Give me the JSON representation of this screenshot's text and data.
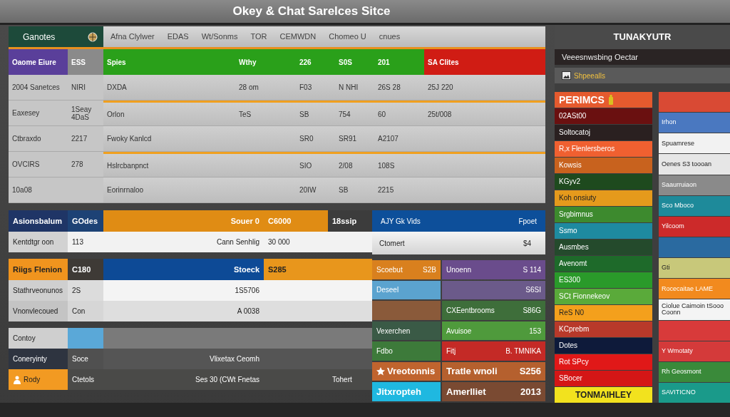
{
  "window": {
    "title": "Okey & Chat Sarelces Sitce"
  },
  "board": {
    "corner": "Ganotes",
    "header": [
      "Afna Clylwer",
      "EDAS",
      "Wt/Sonms",
      "TOR",
      "CEMWDN",
      "Chomeo U",
      "cnues"
    ],
    "rows": [
      {
        "kind": "accent",
        "rule_above": false,
        "cells": [
          "Oaome Eiure",
          "ESS",
          "Spies",
          "Wthy",
          "226",
          "S0S",
          "201",
          "SA Clites"
        ]
      },
      {
        "kind": "plain",
        "rule_above": false,
        "cells": [
          "2004 Sanetces",
          "NIRI",
          "DXDA",
          "28 om",
          "F03",
          "N NHI",
          "26S 28",
          "25J 220"
        ]
      },
      {
        "kind": "plain",
        "rule_above": true,
        "cells": [
          "Eaxesey",
          "1Seay 4DaS",
          "Orlon",
          "TeS",
          "SB",
          "754",
          "60",
          "25t/008"
        ]
      },
      {
        "kind": "plain",
        "rule_above": false,
        "cells": [
          "Ctbraxdo",
          "2217",
          "Fwoky Kanlcd",
          null,
          "SR0",
          "SR91",
          "A2107",
          null
        ]
      },
      {
        "kind": "plain",
        "rule_above": true,
        "cells": [
          "OVCIRS",
          "278",
          "Hslrcbanpnct",
          null,
          "SIO",
          "2/08",
          "108S",
          null
        ]
      },
      {
        "kind": "plain",
        "rule_above": false,
        "cells": [
          "10a08",
          null,
          "Eorinrnaloo",
          null,
          "20IW",
          "SB",
          "2215",
          null
        ]
      }
    ]
  },
  "ledger": [
    {
      "kind": "band",
      "cells": [
        {
          "text": "Asionsbalum",
          "color": "#1f3566"
        },
        {
          "text": "GOdes",
          "color": "#1d4275"
        },
        {
          "text": "Souer 0",
          "color": "#e08c14"
        },
        {
          "text": "C6000",
          "color": "#e08c14"
        },
        {
          "text": "18ssip",
          "color": "#3c3c3c"
        }
      ]
    },
    {
      "kind": "line",
      "cells": [
        {
          "text": "Kentdtgr oon",
          "color": "#d2d2d2"
        },
        {
          "text": "113",
          "color": "#f2f2f2"
        },
        {
          "text": "Cann Senhlig",
          "color": "#f2f2f2"
        },
        {
          "text": "30 000",
          "color": "#f2f2f2"
        },
        {
          "color": "#f2f2f2"
        }
      ]
    },
    {
      "kind": "gap"
    },
    {
      "kind": "band",
      "cells": [
        {
          "text": "Riigs Flenion",
          "color": "#f0941e"
        },
        {
          "text": "C180",
          "color": "#3e3a36"
        },
        {
          "text": "Stoeck",
          "color": "#0d4a96"
        },
        {
          "text": "S285",
          "color": "#e8961c"
        },
        {
          "color": "#e8961c"
        }
      ]
    },
    {
      "kind": "line",
      "cells": [
        {
          "text": "Stathrveonunos",
          "color": "#cfcfcf"
        },
        {
          "text": "2S",
          "color": "#dcdcdc"
        },
        {
          "text": "1S5706",
          "color": "#f4f4f4"
        },
        {
          "color": "#f4f4f4"
        },
        {
          "color": "#f4f4f4"
        }
      ]
    },
    {
      "kind": "line",
      "cells": [
        {
          "text": "Vnonvlecoued",
          "color": "#c4c4c4"
        },
        {
          "text": "Con",
          "color": "#d6d6d6"
        },
        {
          "text": "A 0038",
          "color": "#dedede"
        },
        {
          "color": "#dedede"
        },
        {
          "color": "#dedede"
        }
      ]
    },
    {
      "kind": "gap"
    },
    {
      "kind": "line",
      "cells": [
        {
          "text": "Contoy",
          "color": "#cfcfcf"
        },
        {
          "color": "#5aa8d8"
        },
        {
          "color": "#7a7a7a"
        },
        {
          "color": "#7a7a7a"
        },
        {
          "color": "#7a7a7a"
        }
      ]
    },
    {
      "kind": "line",
      "cells": [
        {
          "text": "Coneryinty",
          "color": "#2e3440"
        },
        {
          "text": "Soce",
          "color": "#505050"
        },
        {
          "text": "Vlixetax Ceomh",
          "color": "#555555"
        },
        {
          "color": "#555555"
        },
        {
          "color": "#555555"
        }
      ]
    },
    {
      "kind": "line",
      "cells": [
        {
          "text": "Rody",
          "color": "#f29a22"
        },
        {
          "text": "Ctetols",
          "color": "#4a4a48"
        },
        {
          "text": "Ses 30 (CWt Fnetas",
          "color": "#4a4a48"
        },
        {
          "color": "#4a4a48"
        },
        {
          "text": "Tohert",
          "color": "#4a4a48"
        }
      ]
    }
  ],
  "orders": {
    "header": {
      "text": "AJY Gk Vids",
      "value": "Fpoet"
    },
    "summary": {
      "text": "Ctomert",
      "value": "$4"
    },
    "rows": [
      {
        "left": {
          "text": "Scoebut",
          "value": "S2B",
          "color": "#d9801e"
        },
        "right": {
          "text": "Unoenn",
          "value": "S 114",
          "color": "#6a4c8c"
        }
      },
      {
        "left": {
          "text": "Deseel",
          "color": "#5ba3cf"
        },
        "right": {
          "value": "S6SI",
          "color": "#6b5a8a"
        }
      },
      {
        "left": {
          "color": "#8a5a3a"
        },
        "right": {
          "text": "CXEentbrooms",
          "value": "S86G",
          "color": "#3e6e3a"
        }
      },
      {
        "left": {
          "text": "Vexerchen",
          "color": "#3a5a46"
        },
        "right": {
          "text": "Avuisoe",
          "value": "153",
          "color": "#4f9a3c"
        }
      },
      {
        "left": {
          "text": "Fdbo",
          "color": "#3d7a3a"
        },
        "right": {
          "text": "Fitj",
          "value": "B. TMNIKA",
          "color": "#c42a26"
        }
      },
      {
        "left": {
          "text": "Vreotonnis",
          "color": "#c0642e"
        },
        "right": {
          "text": "Tratle wnoli",
          "value": "S256",
          "color": "#b5602e"
        }
      },
      {
        "left": {
          "text": "Jitxropteh",
          "color": "#1fb8e0"
        },
        "right": {
          "text": "Amerlliet",
          "value": "2013",
          "color": "#7a4a32"
        }
      }
    ]
  },
  "panel": {
    "title": "TUNAKYUTR",
    "subtitle": "Veeesnwsbing Oectar",
    "shop": "Shpeealls",
    "left": [
      {
        "text": "PERIMCS",
        "color": "#e55a2e"
      },
      {
        "text": "02ASt00",
        "color": "#6a1010"
      },
      {
        "text": "Soltocatoj",
        "color": "#2a2020"
      },
      {
        "text": "R,x Flenlersberos",
        "color": "#f06030"
      },
      {
        "text": "Kowsis",
        "color": "#c8621e"
      },
      {
        "text": "KGyv2",
        "color": "#1e4a1e"
      },
      {
        "text": "Koh onsiuty",
        "color": "#e59a1c"
      },
      {
        "text": "Srgbimnus",
        "color": "#3d8a2e"
      },
      {
        "text": "Ssmo",
        "color": "#1e8aa0"
      },
      {
        "text": "Ausmbes",
        "color": "#244a2c"
      },
      {
        "text": "Avenomt",
        "color": "#1e6a2a"
      },
      {
        "text": "ES300",
        "color": "#2a9a2a"
      },
      {
        "text": "SCt Fionnekeov",
        "color": "#5aaa3a"
      },
      {
        "text": "ReS N0",
        "color": "#f4a01c"
      },
      {
        "text": "KCprebm",
        "color": "#b8392a"
      },
      {
        "text": "Dotes",
        "color": "#0e1a3a"
      },
      {
        "text": "Rot SPcy",
        "color": "#e01818"
      },
      {
        "text": "SBocer",
        "color": "#d41616"
      },
      {
        "text": "TONMAIHLEY",
        "color": "#f2e21e"
      }
    ],
    "right": [
      {
        "color": "#d94a34"
      },
      {
        "text": "Irhon",
        "color": "#4a78c0"
      },
      {
        "text": "Spuamrese",
        "color": "#f2f2f2"
      },
      {
        "text": "Oenes S3 toooan",
        "color": "#e6e6e6"
      },
      {
        "text": "Saaurruiaon",
        "color": "#8a8a8a"
      },
      {
        "text": "Sco Mboco",
        "color": "#1e8a9a"
      },
      {
        "text": "Yilcoom",
        "color": "#cc2a2a"
      },
      {
        "color": "#2a6aa0"
      },
      {
        "text": "Gti",
        "color": "#c8c87a"
      },
      {
        "text": "Rocecaitae LAME",
        "color": "#f28a1e"
      },
      {
        "text": "Ciolue Caimoin tSooo Coonn",
        "color": "#f4f4f4"
      },
      {
        "color": "#d83a3a"
      },
      {
        "text": "Y Wmotaty",
        "color": "#d43a3a"
      },
      {
        "text": "Rh Geosmont",
        "color": "#3a8a3a"
      },
      {
        "text": "SAVITICNO",
        "color": "#1a9a8a"
      }
    ]
  }
}
